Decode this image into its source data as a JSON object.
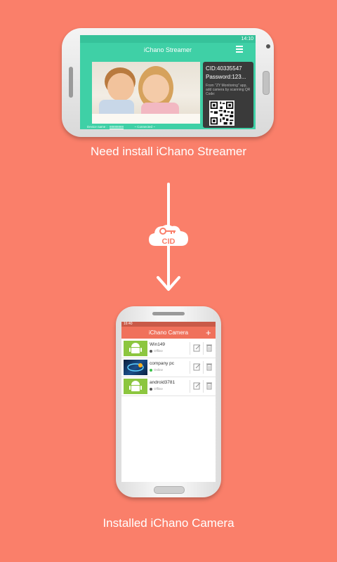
{
  "top_phone": {
    "status_time": "14:10",
    "app_title": "iChano Streamer",
    "cid_label": "CID:40335547",
    "password_label": "Password:123...",
    "instruction": "From \"ZY Monitoring\" app, add camera by scanning QR Code:",
    "device_name_label": "Device name :",
    "device_name_value": "88888888",
    "connected_label": "~ Connected ~"
  },
  "caption_top": "Need install iChano Streamer",
  "cid_badge_text": "CID",
  "bottom_phone": {
    "status_time": "16:40",
    "app_title": "iChano Camera",
    "add_label": "+",
    "cameras": [
      {
        "name": "Win149",
        "status": "Offline",
        "status_color": "#555555",
        "thumb": "android-icon"
      },
      {
        "name": "company pc",
        "status": "Online",
        "status_color": "#3cc24a",
        "thumb": "camera-snapshot"
      },
      {
        "name": "android3781",
        "status": "Offline",
        "status_color": "#555555",
        "thumb": "android-icon"
      }
    ]
  },
  "caption_bottom": "Installed iChano Camera",
  "colors": {
    "background": "#fa7f6a",
    "streamer_accent": "#3fd0a6",
    "camera_accent": "#f0715b",
    "android_green": "#8cc63f"
  }
}
